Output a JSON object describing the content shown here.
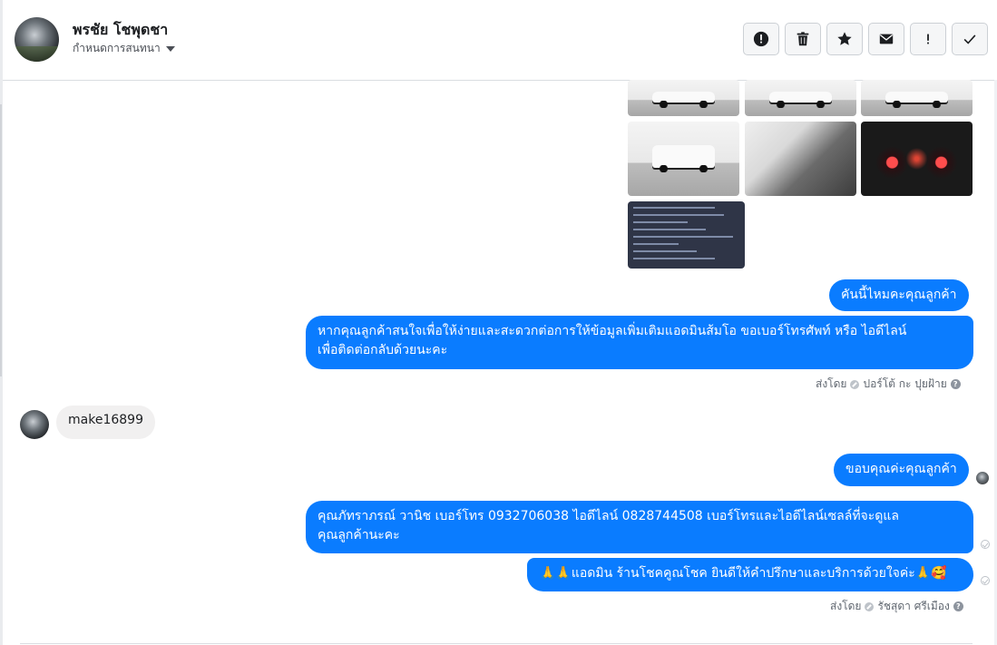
{
  "header": {
    "name": "พรชัย โชพุดชา",
    "subtitle": "กำหนดการสนทนา"
  },
  "toolbar": {
    "buttons": [
      "mark-important",
      "delete",
      "star",
      "email",
      "spam",
      "done"
    ]
  },
  "messages": {
    "out1": "คันนี้ไหมคะคุณลูกค้า",
    "out2_line1": "หากคุณลูกค้าสนใจเพื่อให้ง่ายและสะดวกต่อการให้ข้อมูลเพิ่มเติมแอดมินส้มโอ ขอเบอร์โทรศัพท์ หรือ ไอดีไลน์",
    "out2_line2": "เพื่อติดต่อกลับด้วยนะคะ",
    "sent_by_1_prefix": "ส่งโดย",
    "sent_by_1_name": "ปอร์โต้ กะ ปุยฝ้าย",
    "in1": "make16899",
    "out3": "ขอบคุณค่ะคุณลูกค้า",
    "out4_line1": "คุณภัทราภรณ์  วานิช      เบอร์โทร 0932706038  ไอดีไลน์ 0828744508   เบอร์โทรและไอดีไลน์เซลล์ที่จะดูแล",
    "out4_line2": "คุณลูกค้านะคะ",
    "out5": "🙏🙏แอดมิน ร้านโชคคูณโชค ยินดีให้คำปรึกษาและบริการด้วยใจค่ะ🙏🥰",
    "sent_by_2_prefix": "ส่งโดย",
    "sent_by_2_name": "รัชสุดา ศรีเมือง"
  },
  "colors": {
    "outgoing_bubble": "#0a7cff",
    "incoming_bubble": "#f1f0f0"
  }
}
